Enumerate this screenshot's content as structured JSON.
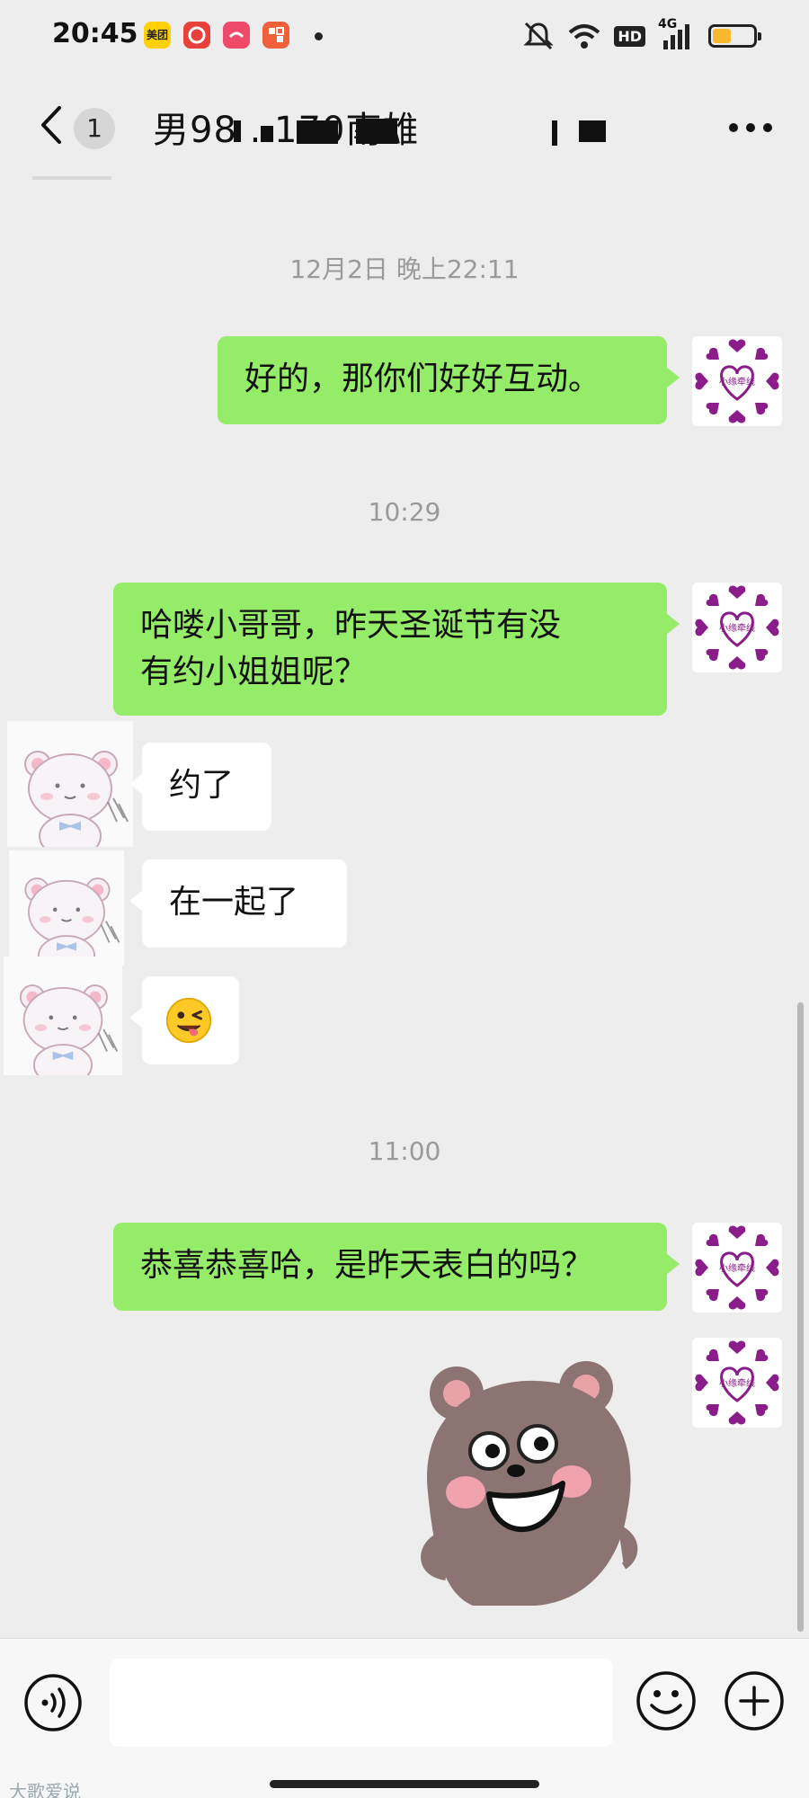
{
  "status_bar": {
    "time": "20:45",
    "network": "4G",
    "hd": "HD",
    "battery_level": 0.45,
    "app_icons": [
      {
        "name": "meituan-icon",
        "color": "#ffd100",
        "label": "美团"
      },
      {
        "name": "netease-music-icon",
        "color": "#e8413b"
      },
      {
        "name": "app-face-icon",
        "color": "#ef4a6a"
      },
      {
        "name": "app-grid-icon",
        "color": "#f0603a"
      }
    ]
  },
  "header": {
    "unread_count": "1",
    "title": "男98 . 170南雄"
  },
  "messages": {
    "time1": "12月2日 晚上22:11",
    "m1": "好的，那你们好好互动。",
    "time2": "10:29",
    "m2_line1": "哈喽小哥哥，昨天圣诞节有没",
    "m2_line2": "有约小姐姐呢？",
    "m3": "约了",
    "m4": "在一起了",
    "m5": "😜",
    "time3": "11:00",
    "m6": "恭喜恭喜哈，是昨天表白的吗？"
  },
  "avatar_self": {
    "label": "小缘牵线",
    "heart_color": "#8a1d8a"
  },
  "colors": {
    "out_bubble": "#95ec69",
    "in_bubble": "#ffffff",
    "background": "#ededed"
  },
  "input": {
    "placeholder": ""
  },
  "watermark": "大歌爱说"
}
